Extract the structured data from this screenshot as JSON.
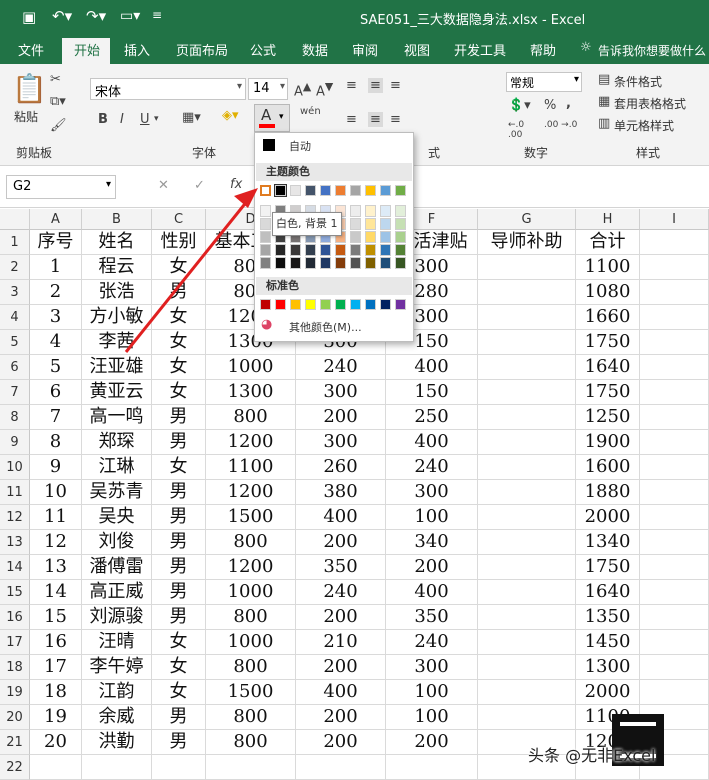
{
  "app": {
    "title": "SAE051_三大数据隐身法.xlsx  -  Excel"
  },
  "tabs": [
    "文件",
    "开始",
    "插入",
    "页面布局",
    "公式",
    "数据",
    "审阅",
    "视图",
    "开发工具",
    "帮助"
  ],
  "tell_me": "告诉我你想要做什么",
  "ribbon": {
    "paste": "粘贴",
    "clipboard": "剪贴板",
    "font_name": "宋体",
    "font_size": "14",
    "font_group": "字体",
    "align_partial": "式",
    "number_format": "常规",
    "number_group": "数字",
    "cond_format": "条件格式",
    "table_format": "套用表格格式",
    "cell_style": "单元格样式",
    "styles_group": "样式",
    "bold": "B",
    "italic": "I",
    "underline": "U",
    "wen": "wén",
    "percent": "%",
    "comma": ",",
    "inc_dec": "←.0 .00",
    "dec_dec": ".00 →.0",
    "font_color_glyph": "A",
    "font_color_bar": "#ff0000"
  },
  "formula": {
    "name_box": "G2",
    "fx": "fx"
  },
  "columns": [
    "A",
    "B",
    "C",
    "D",
    "E",
    "F",
    "G",
    "H",
    "I"
  ],
  "rows": [
    [
      "序号",
      "姓名",
      "性别",
      "基本工资",
      "",
      "生活津贴",
      "导师补助",
      "合计"
    ],
    [
      "1",
      "程云",
      "女",
      "800",
      "",
      "300",
      "",
      "1100"
    ],
    [
      "2",
      "张浩",
      "男",
      "800",
      "",
      "280",
      "",
      "1080"
    ],
    [
      "3",
      "方小敏",
      "女",
      "1200",
      "",
      "300",
      "",
      "1660"
    ],
    [
      "4",
      "李茜",
      "女",
      "1300",
      "300",
      "150",
      "",
      "1750"
    ],
    [
      "5",
      "汪亚雄",
      "女",
      "1000",
      "240",
      "400",
      "",
      "1640"
    ],
    [
      "6",
      "黄亚云",
      "女",
      "1300",
      "300",
      "150",
      "",
      "1750"
    ],
    [
      "7",
      "高一鸣",
      "男",
      "800",
      "200",
      "250",
      "",
      "1250"
    ],
    [
      "8",
      "郑琛",
      "男",
      "1200",
      "300",
      "400",
      "",
      "1900"
    ],
    [
      "9",
      "江琳",
      "女",
      "1100",
      "260",
      "240",
      "",
      "1600"
    ],
    [
      "10",
      "吴苏青",
      "男",
      "1200",
      "380",
      "300",
      "",
      "1880"
    ],
    [
      "11",
      "吴央",
      "男",
      "1500",
      "400",
      "100",
      "",
      "2000"
    ],
    [
      "12",
      "刘俊",
      "男",
      "800",
      "200",
      "340",
      "",
      "1340"
    ],
    [
      "13",
      "潘傅雷",
      "男",
      "1200",
      "350",
      "200",
      "",
      "1750"
    ],
    [
      "14",
      "高正威",
      "男",
      "1000",
      "240",
      "400",
      "",
      "1640"
    ],
    [
      "15",
      "刘源骏",
      "男",
      "800",
      "200",
      "350",
      "",
      "1350"
    ],
    [
      "16",
      "汪晴",
      "女",
      "1000",
      "210",
      "240",
      "",
      "1450"
    ],
    [
      "17",
      "李午婷",
      "女",
      "800",
      "200",
      "300",
      "",
      "1300"
    ],
    [
      "18",
      "江韵",
      "女",
      "1500",
      "400",
      "100",
      "",
      "2000"
    ],
    [
      "19",
      "余威",
      "男",
      "800",
      "200",
      "100",
      "",
      "1100"
    ],
    [
      "20",
      "洪勤",
      "男",
      "800",
      "200",
      "200",
      "",
      "1200"
    ],
    [
      "",
      "",
      " ",
      "",
      "",
      "",
      "",
      ""
    ]
  ],
  "palette": {
    "auto_label": "自动",
    "theme_label": "主题颜色",
    "standard_label": "标准色",
    "more_label": "其他颜色(M)...",
    "tooltip": "白色, 背景 1",
    "theme_colors": [
      "#ffffff",
      "#000000",
      "#e7e6e6",
      "#44546a",
      "#4472c4",
      "#ed7d31",
      "#a5a5a5",
      "#ffc000",
      "#5b9bd5",
      "#70ad47"
    ],
    "tint_rows": [
      [
        "#f2f2f2",
        "#7f7f7f",
        "#d0cece",
        "#d6dce4",
        "#d9e2f3",
        "#fbe5d6",
        "#ededed",
        "#fff2cc",
        "#ddebf7",
        "#e2efda"
      ],
      [
        "#d9d9d9",
        "#595959",
        "#aeaaaa",
        "#adb9ca",
        "#b4c6e7",
        "#f8cbad",
        "#dbdbdb",
        "#ffe699",
        "#bdd7ee",
        "#c6e0b4"
      ],
      [
        "#bfbfbf",
        "#404040",
        "#757171",
        "#8497b0",
        "#8eaadb",
        "#f4b183",
        "#c9c9c9",
        "#ffd966",
        "#9dc3e6",
        "#a9d08e"
      ],
      [
        "#a6a6a6",
        "#262626",
        "#3a3838",
        "#333f4f",
        "#2f5496",
        "#c55a11",
        "#7b7b7b",
        "#bf8f00",
        "#2e75b6",
        "#548235"
      ],
      [
        "#808080",
        "#0d0d0d",
        "#171616",
        "#222a35",
        "#1f3864",
        "#833c0b",
        "#525252",
        "#7f6000",
        "#1f4e79",
        "#375623"
      ]
    ],
    "standard_colors": [
      "#c00000",
      "#ff0000",
      "#ffc000",
      "#ffff00",
      "#92d050",
      "#00b050",
      "#00b0f0",
      "#0070c0",
      "#002060",
      "#7030a0"
    ]
  },
  "watermark": {
    "text": "头条 @无非Excel"
  }
}
